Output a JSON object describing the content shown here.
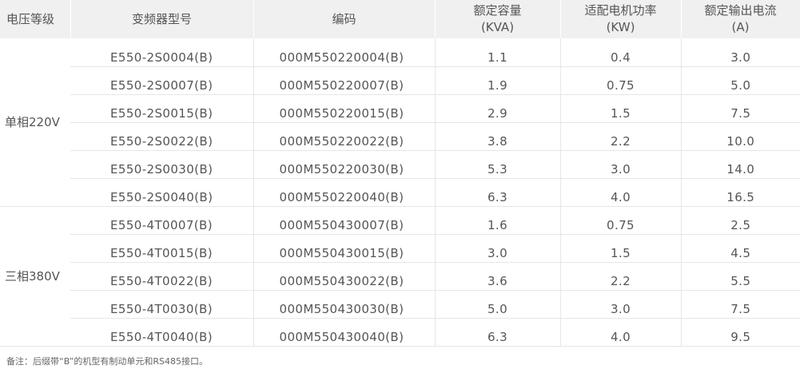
{
  "headers": [
    {
      "line1": "电压等级",
      "line2": ""
    },
    {
      "line1": "变频器型号",
      "line2": ""
    },
    {
      "line1": "编码",
      "line2": ""
    },
    {
      "line1": "额定容量",
      "line2": "(KVA)"
    },
    {
      "line1": "适配电机功率",
      "line2": "(KW)"
    },
    {
      "line1": "额定输出电流",
      "line2": "(A)"
    }
  ],
  "groups": [
    {
      "label": "单相220V",
      "rows": [
        {
          "model": "E550-2S0004(B)",
          "code": "000M550220004(B)",
          "kva": "1.1",
          "kw": "0.4",
          "amp": "3.0"
        },
        {
          "model": "E550-2S0007(B)",
          "code": "000M550220007(B)",
          "kva": "1.9",
          "kw": "0.75",
          "amp": "5.0"
        },
        {
          "model": "E550-2S0015(B)",
          "code": "000M550220015(B)",
          "kva": "2.9",
          "kw": "1.5",
          "amp": "7.5"
        },
        {
          "model": "E550-2S0022(B)",
          "code": "000M550220022(B)",
          "kva": "3.8",
          "kw": "2.2",
          "amp": "10.0"
        },
        {
          "model": "E550-2S0030(B)",
          "code": "000M550220030(B)",
          "kva": "5.3",
          "kw": "3.0",
          "amp": "14.0"
        },
        {
          "model": "E550-2S0040(B)",
          "code": "000M550220040(B)",
          "kva": "6.3",
          "kw": "4.0",
          "amp": "16.5"
        }
      ]
    },
    {
      "label": "三相380V",
      "rows": [
        {
          "model": "E550-4T0007(B)",
          "code": "000M550430007(B)",
          "kva": "1.6",
          "kw": "0.75",
          "amp": "2.5"
        },
        {
          "model": "E550-4T0015(B)",
          "code": "000M550430015(B)",
          "kva": "3.0",
          "kw": "1.5",
          "amp": "4.5"
        },
        {
          "model": "E550-4T0022(B)",
          "code": "000M550430022(B)",
          "kva": "3.6",
          "kw": "2.2",
          "amp": "5.5"
        },
        {
          "model": "E550-4T0030(B)",
          "code": "000M550430030(B)",
          "kva": "5.0",
          "kw": "3.0",
          "amp": "7.5"
        },
        {
          "model": "E550-4T0040(B)",
          "code": "000M550430040(B)",
          "kva": "6.3",
          "kw": "4.0",
          "amp": "9.5"
        }
      ]
    }
  ],
  "note": "备注：后缀带“B”的机型有制动单元和RS485接口。"
}
